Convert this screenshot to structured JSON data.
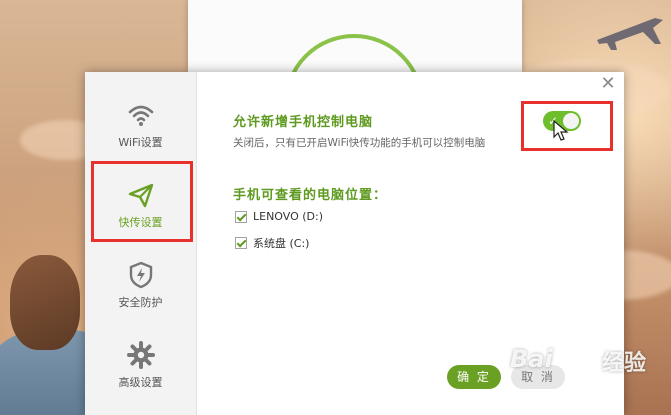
{
  "sidebar": {
    "items": [
      {
        "label": "WiFi设置",
        "icon": "wifi-icon",
        "active": false
      },
      {
        "label": "快传设置",
        "icon": "paper-plane-icon",
        "active": true
      },
      {
        "label": "安全防护",
        "icon": "shield-bolt-icon",
        "active": false
      },
      {
        "label": "高级设置",
        "icon": "gear-icon",
        "active": false
      }
    ]
  },
  "main": {
    "allow_control_title": "允许新增手机控制电脑",
    "allow_control_desc": "关闭后，只有已开启WiFi快传功能的手机可以控制电脑",
    "toggle_on": true,
    "locations_title": "手机可查看的电脑位置：",
    "drives": [
      {
        "label": "LENOVO (D:)",
        "checked": true
      },
      {
        "label": "系统盘 (C:)",
        "checked": true
      }
    ]
  },
  "buttons": {
    "ok": "确 定",
    "cancel": "取 消"
  },
  "watermark": {
    "brand_left": "Bai",
    "brand_right": "经验"
  },
  "colors": {
    "accent": "#6aa125",
    "title_green": "#5e9a1f",
    "highlight": "#e8302d",
    "toggle": "#6ebd2c"
  }
}
